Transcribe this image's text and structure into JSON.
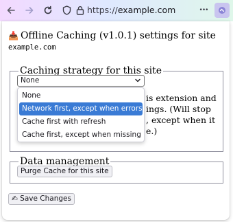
{
  "browser": {
    "url_scheme": "https://",
    "url_domain": "example.com",
    "menu_glyph": "•••"
  },
  "popup": {
    "title_icon": "📥",
    "title": "Offline Caching (v1.0.1) settings for site",
    "site": "example.com",
    "strategy": {
      "legend": "Caching strategy for this site",
      "selected": "None",
      "options": [
        "None",
        "Network first, except when errors",
        "Cache first with refresh",
        "Cache first, except when missing"
      ],
      "highlighted_index": 1,
      "description_lines": [
        "is extension and",
        "ings. (Will stop",
        ", except when it",
        "e.)"
      ]
    },
    "data_management": {
      "legend": "Data management",
      "purge_label": "Purge Cache for this site"
    },
    "save_icon": "✍",
    "save_label": "Save Changes"
  },
  "colors": {
    "highlight": "#3a7bd5",
    "extension_button_bg": "#c9c5ef"
  },
  "icons": [
    "back-arrow-icon",
    "forward-arrow-icon",
    "reload-icon",
    "shield-icon",
    "lock-icon",
    "more-menu-icon",
    "extension-icon",
    "inbox-tray-icon",
    "writing-hand-icon",
    "chevron-down-icon"
  ]
}
